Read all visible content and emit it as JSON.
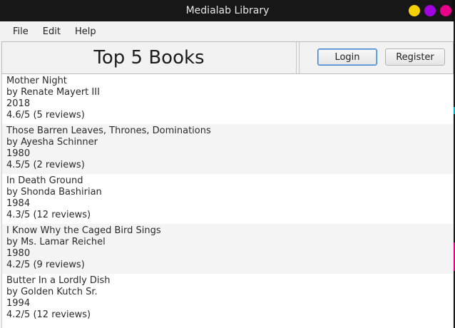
{
  "window": {
    "title": "Medialab Library"
  },
  "menu": {
    "items": [
      "File",
      "Edit",
      "Help"
    ]
  },
  "header": {
    "title": "Top 5 Books",
    "login_label": "Login",
    "register_label": "Register"
  },
  "books": [
    {
      "title": "Mother Night",
      "author": "by Renate Mayert III",
      "year": "2018",
      "rating": "4.6/5 (5 reviews)"
    },
    {
      "title": "Those Barren Leaves, Thrones, Dominations",
      "author": "by Ayesha Schinner",
      "year": "1980",
      "rating": "4.5/5 (2 reviews)"
    },
    {
      "title": "In Death Ground",
      "author": "by Shonda Bashirian",
      "year": "1984",
      "rating": "4.3/5 (12 reviews)"
    },
    {
      "title": "I Know Why the Caged Bird Sings",
      "author": "by Ms. Lamar Reichel",
      "year": "1980",
      "rating": "4.2/5 (9 reviews)"
    },
    {
      "title": "Butter In a Lordly Dish",
      "author": "by Golden Kutch Sr.",
      "year": "1994",
      "rating": "4.2/5 (12 reviews)"
    }
  ],
  "colors": {
    "minimize": "#f7d000",
    "maximize": "#a300e0",
    "close": "#e8008a",
    "focus": "#3d86c6"
  }
}
